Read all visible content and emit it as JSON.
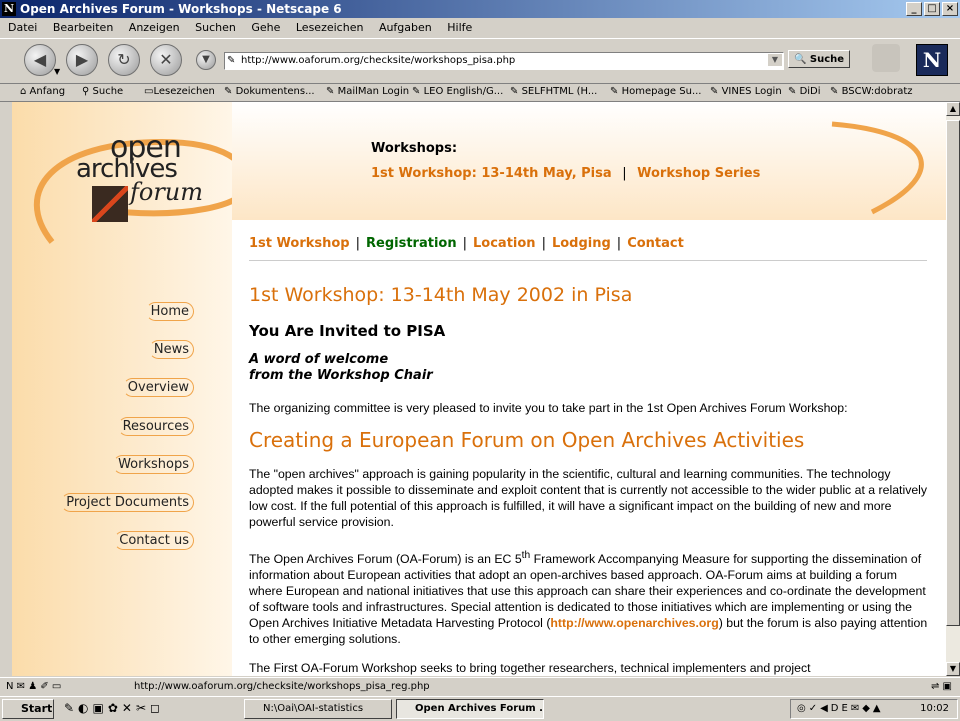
{
  "window": {
    "title": "Open Archives Forum - Workshops - Netscape 6"
  },
  "menu": [
    "Datei",
    "Bearbeiten",
    "Anzeigen",
    "Suchen",
    "Gehe",
    "Lesezeichen",
    "Aufgaben",
    "Hilfe"
  ],
  "toolbar": {
    "url": "http://www.oaforum.org/checksite/workshops_pisa.php",
    "search_label": "Suche"
  },
  "bookmarks": [
    "Anfang",
    "Suche",
    "Lesezeichen",
    "Dokumentens...",
    "MailMan Login",
    "LEO English/G...",
    "SELFHTML (H...",
    "Homepage Su...",
    "VINES Login",
    "DiDi",
    "BSCW:dobratz"
  ],
  "site": {
    "logo": {
      "line1": "open",
      "line2": "archives",
      "line3": "forum"
    },
    "sidenav": [
      "Home",
      "News",
      "Overview",
      "Resources",
      "Workshops",
      "Project Documents",
      "Contact us"
    ],
    "header": {
      "heading": "Workshops:",
      "link1": "1st Workshop: 13-14th May, Pisa",
      "sep": "|",
      "link2": "Workshop Series"
    },
    "subnav": [
      "1st Workshop",
      "Registration",
      "Location",
      "Lodging",
      "Contact"
    ],
    "content": {
      "title": "1st Workshop: 13-14th May 2002 in Pisa",
      "invite": "You Are Invited to PISA",
      "welcome1": "A word of welcome",
      "welcome2": "from the Workshop Chair",
      "intro": "The organizing committee is very pleased to invite you to take part in the 1st Open Archives Forum Workshop:",
      "h2": "Creating a European Forum on Open Archives Activities",
      "p1": "The \"open archives\" approach is gaining popularity in the scientific, cultural and learning communities. The technology adopted makes it possible to disseminate and exploit content that is currently not accessible to the wider public at a relatively low cost. If the full potential of this approach is fulfilled, it will have a significant impact on the building of new and more powerful service provision.",
      "p2a": "The Open Archives Forum (OA-Forum) is an EC 5",
      "p2sup": "th",
      "p2b": " Framework Accompanying Measure for supporting the dissemination of information about European activities that adopt an open-archives based approach. OA-Forum aims at building a forum where European and national initiatives that use this approach can share their experiences and co-ordinate the development of software tools and infrastructures. Special attention is dedicated to those initiatives which are implementing or using the Open Archives Initiative Metadata Harvesting Protocol (",
      "p2link": "http://www.openarchives.org",
      "p2c": ") but the forum is also paying attention to other emerging solutions.",
      "p3": "The First OA-Forum Workshop seeks to bring together researchers, technical implementers and project"
    }
  },
  "status": {
    "text": "http://www.oaforum.org/checksite/workshops_pisa_reg.php"
  },
  "taskbar": {
    "start": "Start",
    "tasks": [
      "N:\\Oai\\OAI-statistics",
      "Open Archives Forum ..."
    ],
    "clock": "10:02"
  }
}
